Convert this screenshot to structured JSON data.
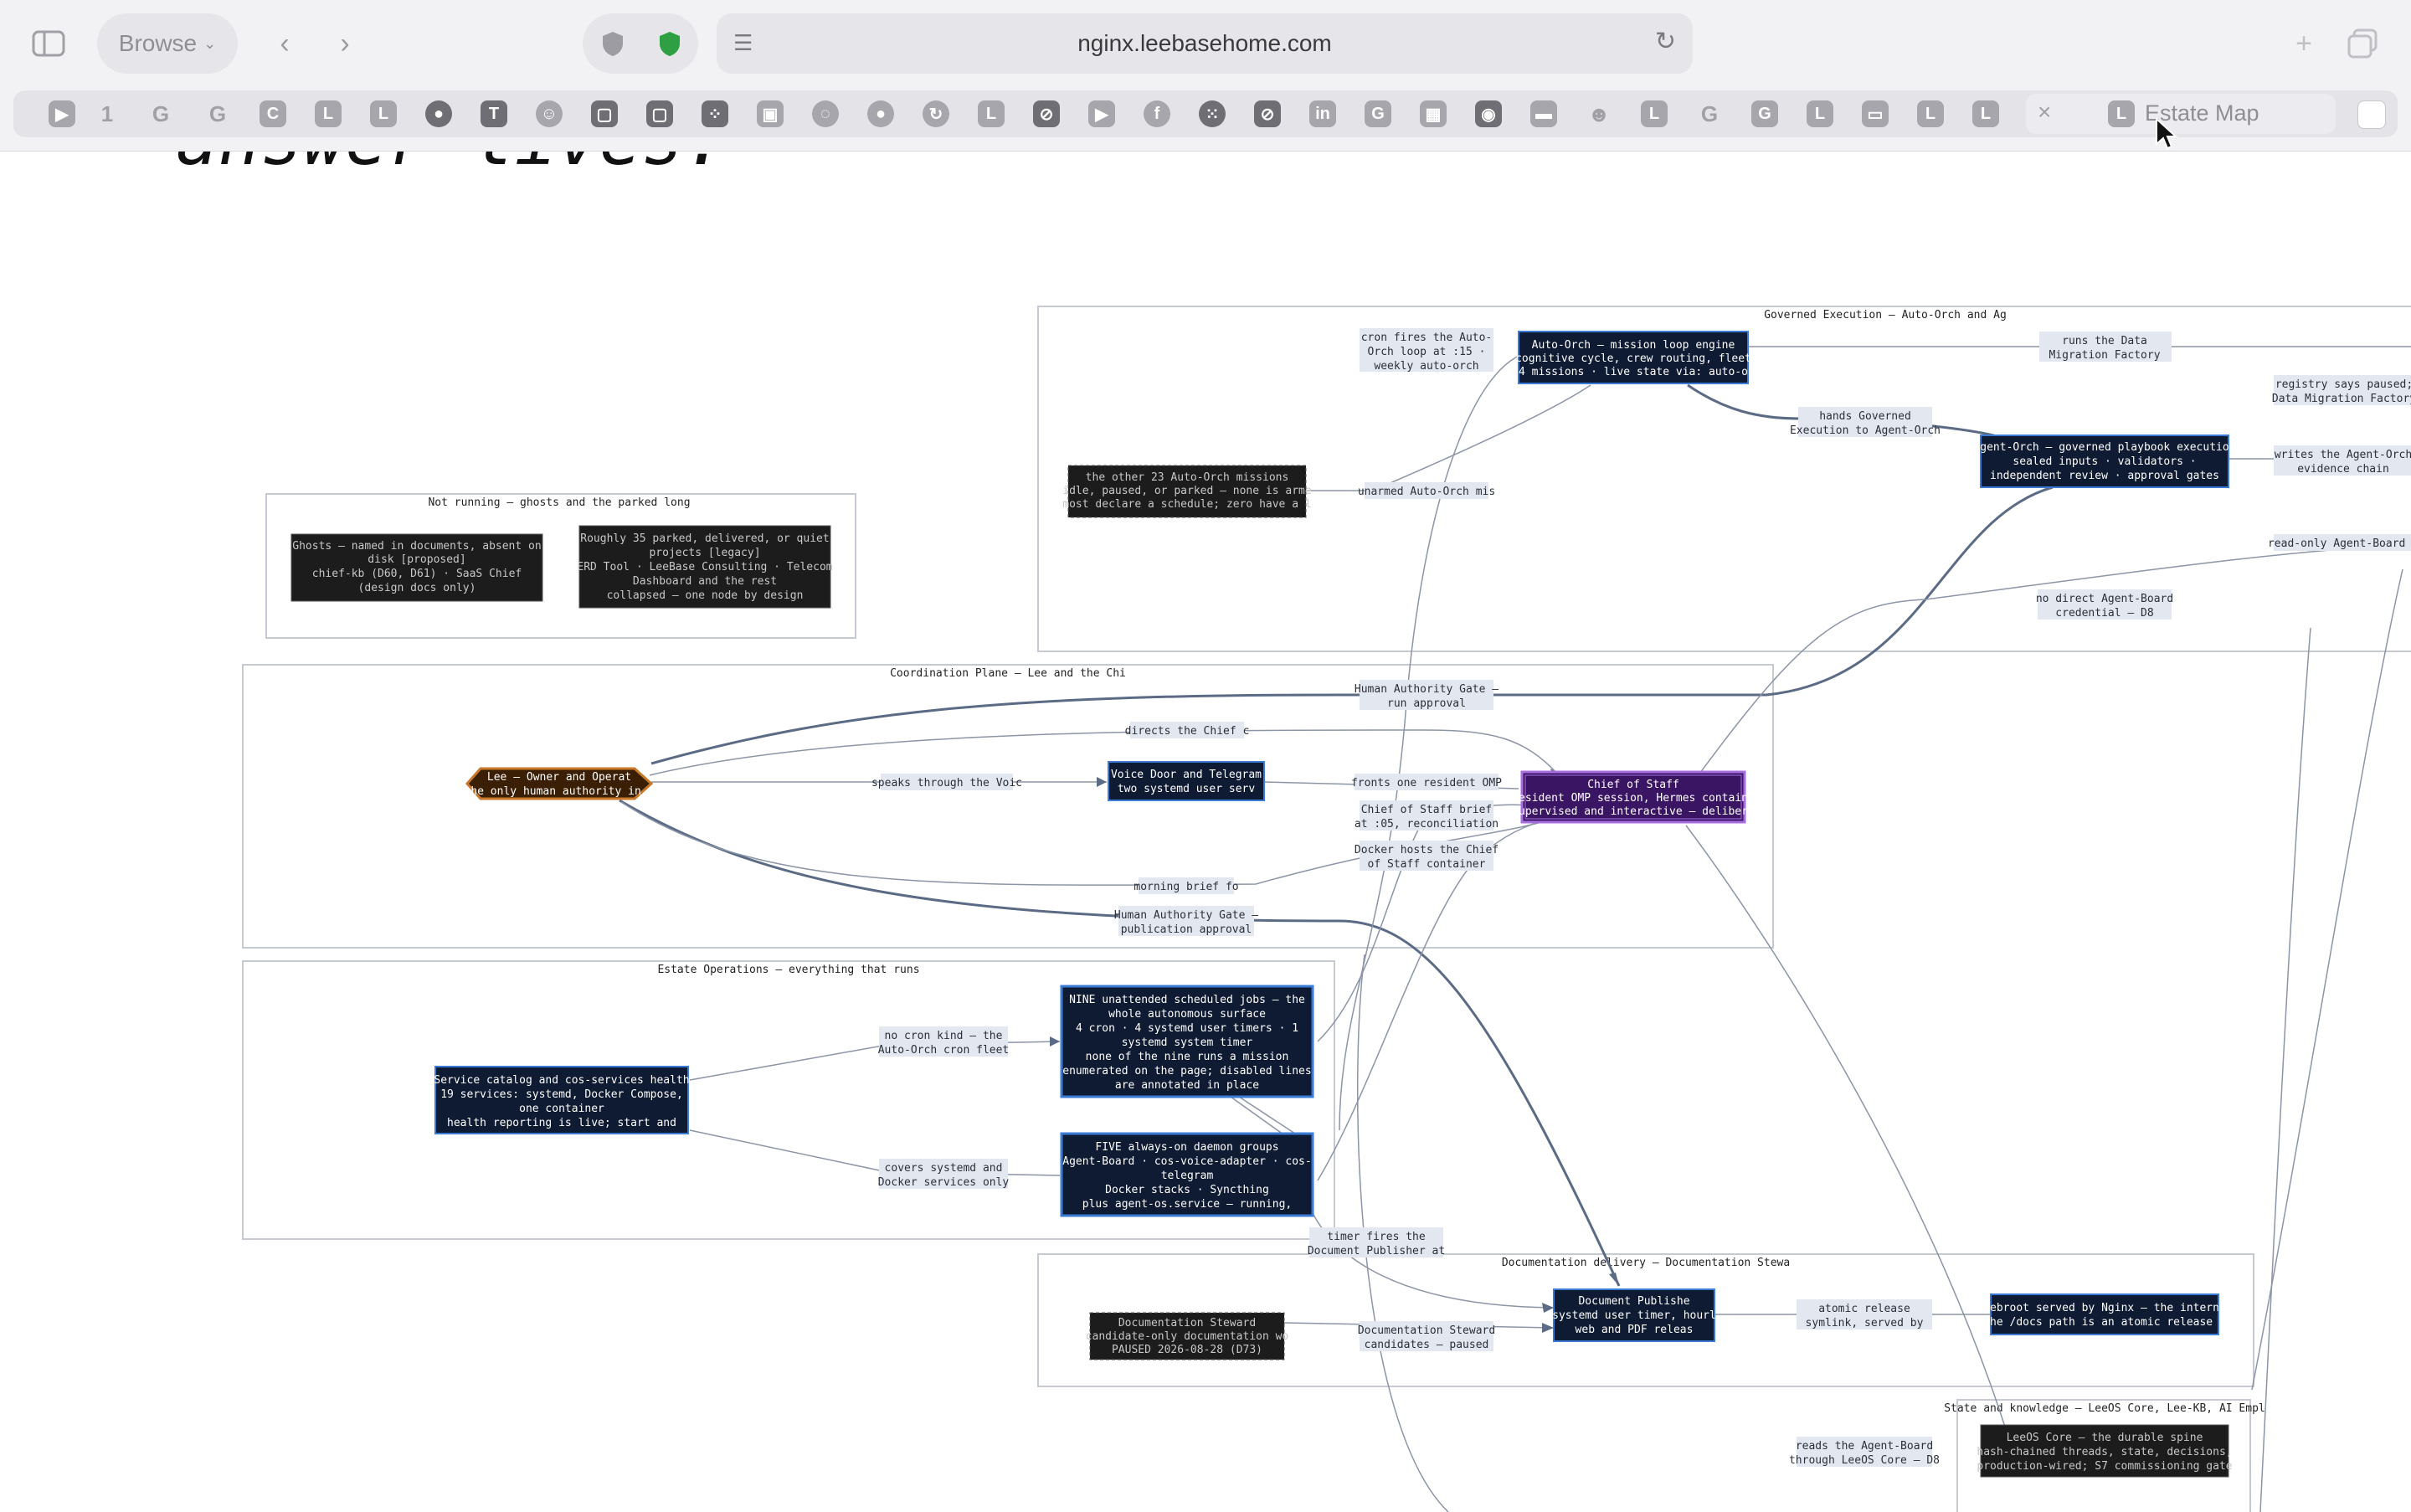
{
  "browser": {
    "browse_label": "Browse",
    "url": "nginx.leebasehome.com",
    "active_tab_title": "Estate Map",
    "active_tab_icon_letter": "L",
    "bookmark_letters": [
      "1",
      "C",
      "L",
      "L",
      "L",
      "L",
      "L",
      "L",
      "L",
      "L"
    ]
  },
  "page": {
    "heading_fragment": "answer lives."
  },
  "diagram": {
    "groups": {
      "governed": "Governed Execution — Auto-Orch and Ag",
      "ghosts": "Not running — ghosts and the parked long",
      "coordination": "Coordination Plane — Lee and the Chi",
      "estate_ops": "Estate Operations — everything that runs",
      "docs": "Documentation delivery — Documentation Stewa",
      "state": "State and knowledge — LeeOS Core, Lee-KB, AI Empl"
    },
    "nodes": {
      "lee": [
        "Lee — Owner and Operat",
        "the only human authority in t"
      ],
      "voice": [
        "Voice Door and Telegram",
        "two systemd user serv"
      ],
      "cos": [
        "Chief of Staff",
        "resident OMP session, Hermes containe",
        "supervised and interactive — delibera"
      ],
      "autoorch": [
        "Auto-Orch — mission loop engine",
        "cognitive cycle, crew routing, fleet",
        "24 missions · live state via: auto-or"
      ],
      "agentorch": [
        "Agent-Orch — governed playbook execution",
        "sealed inputs · validators ·",
        "independent review · approval gates"
      ],
      "other23": [
        "the other 23 Auto-Orch missions",
        "idle, paused, or parked — none is arme",
        "most declare a schedule; zero have a l"
      ],
      "ghosts": [
        "Ghosts — named in documents, absent on",
        "disk [proposed]",
        "chief-kb (D60, D61) · SaaS Chief",
        "(design docs only)"
      ],
      "parked": [
        "Roughly 35 parked, delivered, or quiet",
        "projects [legacy]",
        "ERD Tool · LeeBase Consulting · Telecom",
        "Dashboard and the rest",
        "collapsed — one node by design"
      ],
      "service": [
        "Service catalog and cos-services health",
        "19 services: systemd, Docker Compose,",
        "one container",
        "health reporting is live; start and"
      ],
      "nine": [
        "NINE unattended scheduled jobs — the",
        "whole autonomous surface",
        "4 cron · 4 systemd user timers · 1",
        "systemd system timer",
        "none of the nine runs a mission",
        "enumerated on the page; disabled lines",
        "are annotated in place"
      ],
      "five": [
        "FIVE always-on daemon groups",
        "Agent-Board · cos-voice-adapter · cos-",
        "telegram",
        "Docker stacks · Syncthing",
        "plus agent-os.service — running,"
      ],
      "docsteward": [
        "Documentation Steward",
        "candidate-only documentation wo",
        "PAUSED 2026-08-28 (D73)"
      ],
      "docpub": [
        "Document Publishe",
        "systemd user timer, hourl",
        "web and PDF releas"
      ],
      "webroot": [
        "webroot served by Nginx — the interne",
        "the /docs path is an atomic release :"
      ],
      "leeos": [
        "LeeOS Core — the durable spine",
        "hash-chained threads, state, decisions,",
        "production-wired; S7 commissioning gate"
      ]
    },
    "edge_labels": {
      "cron_fires": [
        "cron fires the Auto-",
        "Orch loop at :15 ·",
        "weekly auto-orch"
      ],
      "runs_dmf": [
        "runs the Data",
        "Migration Factory"
      ],
      "hands_gov": [
        "hands Governed",
        "Execution to Agent-Orch"
      ],
      "registry": [
        "registry says paused;",
        "Data Migration Factory"
      ],
      "writes_chain": [
        "writes the Agent-Orch",
        "evidence chain"
      ],
      "readonly_board": [
        "read-only Agent-Board a"
      ],
      "unarmed": [
        "unarmed Auto-Orch mis"
      ],
      "no_direct": [
        "no direct Agent-Board",
        "credential — D8"
      ],
      "hag_run": [
        "Human Authority Gate —",
        "run approval"
      ],
      "directs": [
        "directs the Chief c"
      ],
      "speaks": [
        "speaks through the Voic"
      ],
      "fronts": [
        "fronts one resident OMP"
      ],
      "cos_brief": [
        "Chief of Staff brief",
        "at :05, reconciliation"
      ],
      "docker_hosts": [
        "Docker hosts the Chief",
        "of Staff container"
      ],
      "morning": [
        "morning brief fo"
      ],
      "hag_pub": [
        "Human Authority Gate —",
        "publication approval"
      ],
      "no_cron": [
        "no cron kind — the",
        "Auto-Orch cron fleet"
      ],
      "covers": [
        "covers systemd and",
        "Docker services only"
      ],
      "timer_fires": [
        "timer fires the",
        "Document Publisher at"
      ],
      "docsteward_cand": [
        "Documentation Steward",
        "candidates — paused"
      ],
      "atomic": [
        "atomic release",
        "symlink, served by"
      ],
      "reads_board": [
        "reads the Agent-Board",
        "through LeeOS Core — D8"
      ]
    }
  },
  "colors": {
    "node_navy": "#0f1b33",
    "node_dark": "#1c1c1c",
    "node_purple": "#3a1563",
    "node_lee": "#3b1f05",
    "edge": "#5b6b85",
    "label_bg": "#e3e8f0",
    "border_blue": "#3a7bd5"
  }
}
